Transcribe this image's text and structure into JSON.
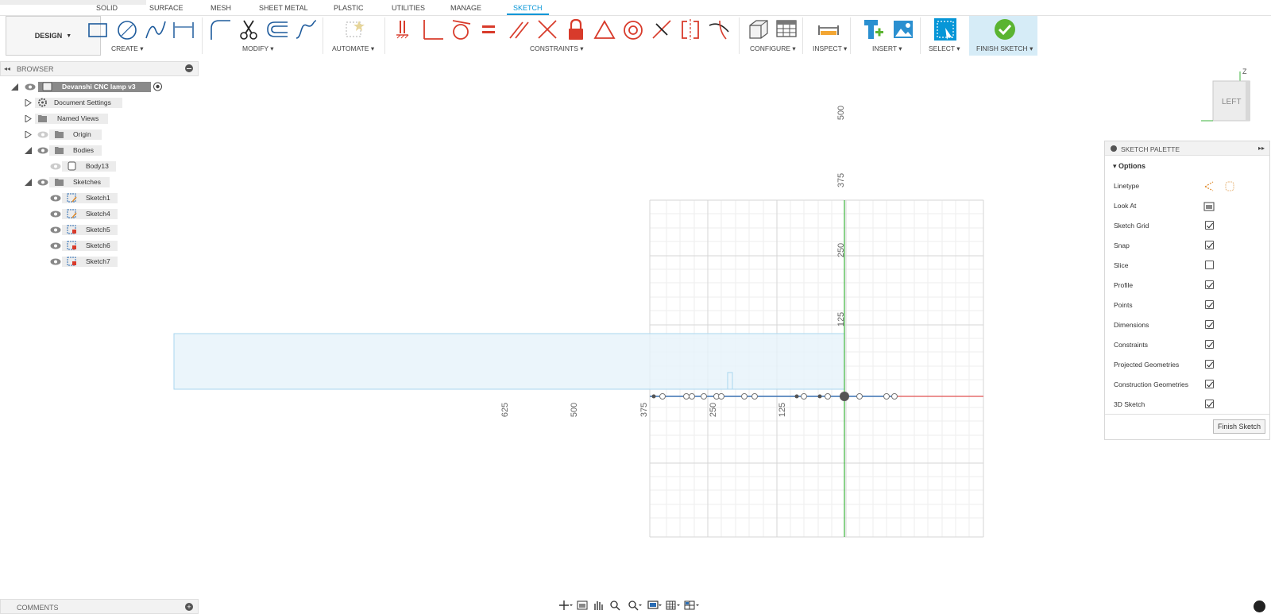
{
  "tabs": [
    {
      "label": "SOLID"
    },
    {
      "label": "SURFACE"
    },
    {
      "label": "MESH"
    },
    {
      "label": "SHEET METAL"
    },
    {
      "label": "PLASTIC"
    },
    {
      "label": "UTILITIES"
    },
    {
      "label": "MANAGE"
    },
    {
      "label": "SKETCH"
    }
  ],
  "active_tab": "SKETCH",
  "toolbar": {
    "workspace": "DESIGN",
    "groups": [
      {
        "label": "CREATE"
      },
      {
        "label": "MODIFY"
      },
      {
        "label": "AUTOMATE"
      },
      {
        "label": "CONSTRAINTS"
      },
      {
        "label": "CONFIGURE"
      },
      {
        "label": "INSPECT"
      },
      {
        "label": "INSERT"
      },
      {
        "label": "SELECT"
      },
      {
        "label": "FINISH SKETCH"
      }
    ],
    "accent_color": "#0696d7",
    "constraint_color": "#d83b2b",
    "finish_color": "#5bb431"
  },
  "browser": {
    "title": "BROWSER",
    "root": {
      "label": "Devanshi CNC lamp v3"
    },
    "items": [
      {
        "label": "Document Settings",
        "icon": "gear-icon"
      },
      {
        "label": "Named Views",
        "icon": "folder-icon"
      },
      {
        "label": "Origin",
        "icon": "folder-icon"
      },
      {
        "label": "Bodies",
        "icon": "folder-icon"
      },
      {
        "label": "Body13",
        "icon": "body-icon"
      },
      {
        "label": "Sketches",
        "icon": "folder-icon"
      },
      {
        "label": "Sketch1",
        "icon": "sketch-icon"
      },
      {
        "label": "Sketch4",
        "icon": "sketch-icon"
      },
      {
        "label": "Sketch5",
        "icon": "sketch-locked-icon"
      },
      {
        "label": "Sketch6",
        "icon": "sketch-locked-icon"
      },
      {
        "label": "Sketch7",
        "icon": "sketch-locked-icon"
      }
    ]
  },
  "comments": {
    "title": "COMMENTS"
  },
  "viewcube": {
    "face": "LEFT",
    "axis": "Z"
  },
  "canvas": {
    "ruler_vertical": [
      "500",
      "375",
      "250",
      "125"
    ],
    "ruler_horizontal": [
      "625",
      "500",
      "375",
      "250",
      "125"
    ]
  },
  "sketch_palette": {
    "title": "SKETCH PALETTE",
    "section": "Options",
    "rows": [
      {
        "label": "Linetype",
        "kind": "icons"
      },
      {
        "label": "Look At",
        "kind": "icon"
      },
      {
        "label": "Sketch Grid",
        "checked": true
      },
      {
        "label": "Snap",
        "checked": true
      },
      {
        "label": "Slice",
        "checked": false
      },
      {
        "label": "Profile",
        "checked": true
      },
      {
        "label": "Points",
        "checked": true
      },
      {
        "label": "Dimensions",
        "checked": true
      },
      {
        "label": "Constraints",
        "checked": true
      },
      {
        "label": "Projected Geometries",
        "checked": true
      },
      {
        "label": "Construction Geometries",
        "checked": true
      },
      {
        "label": "3D Sketch",
        "checked": true
      }
    ],
    "finish_button": "Finish Sketch"
  }
}
